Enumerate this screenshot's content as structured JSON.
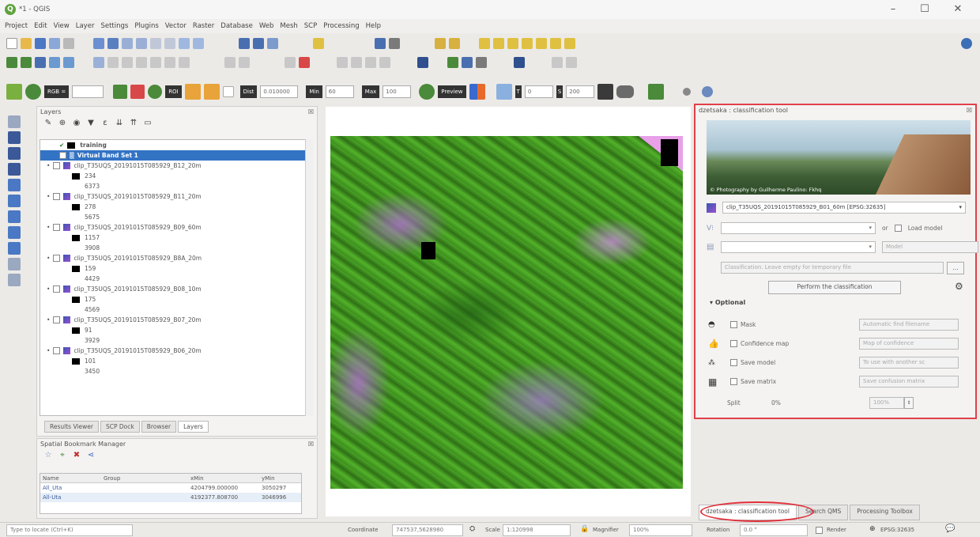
{
  "window": {
    "title": "*1 - QGIS",
    "minimize": "–",
    "maximize": "☐",
    "close": "✕"
  },
  "menu": [
    "Project",
    "Edit",
    "View",
    "Layer",
    "Settings",
    "Plugins",
    "Vector",
    "Raster",
    "Database",
    "Web",
    "Mesh",
    "SCP",
    "Processing",
    "Help"
  ],
  "toolbar": {
    "rgb_select": "RGB =",
    "roi_btn": "ROI",
    "dist_label": "Dist",
    "dist_value": "0.010000",
    "min_label": "Min",
    "min_value": "60",
    "max_label": "Max",
    "max_value": "100",
    "preview_btn": "Preview",
    "t_value": "0",
    "s_value": "200",
    "colors": {
      "yellow": "#f2c233",
      "green": "#4caf50",
      "orange": "#f57c00",
      "blue": "#2196f3",
      "red": "#e53935"
    }
  },
  "layers_panel": {
    "title": "Layers",
    "close": "☒",
    "items": [
      {
        "name": "training",
        "checked": true,
        "sub": null
      },
      {
        "name": "Virtual Band Set 1",
        "checked": true,
        "selected": true,
        "sub": null
      },
      {
        "name": "clip_T35UQS_20191015T085929_B12_20m",
        "checked": false,
        "min": "234",
        "max": "6373"
      },
      {
        "name": "clip_T35UQS_20191015T085929_B11_20m",
        "checked": false,
        "min": "278",
        "max": "5675"
      },
      {
        "name": "clip_T35UQS_20191015T085929_B09_60m",
        "checked": false,
        "min": "1157",
        "max": "3908"
      },
      {
        "name": "clip_T35UQS_20191015T085929_B8A_20m",
        "checked": false,
        "min": "159",
        "max": "4429"
      },
      {
        "name": "clip_T35UQS_20191015T085929_B08_10m",
        "checked": false,
        "min": "175",
        "max": "4569"
      },
      {
        "name": "clip_T35UQS_20191015T085929_B07_20m",
        "checked": false,
        "min": "91",
        "max": "3929"
      },
      {
        "name": "clip_T35UQS_20191015T085929_B06_20m",
        "checked": false,
        "min": "101",
        "max": "3450"
      }
    ],
    "tabs": [
      "Results Viewer",
      "SCP Dock",
      "Browser",
      "Layers"
    ],
    "active_tab": "Layers"
  },
  "bookmarks": {
    "title": "Spatial Bookmark Manager",
    "columns": [
      "Name",
      "Group",
      "xMin",
      "yMin"
    ],
    "rows": [
      {
        "name": "All_Uta",
        "group": "",
        "xmin": "4204799.000000",
        "ymin": "3050297"
      },
      {
        "name": "All-Uta",
        "group": "",
        "xmin": "4192377.808700",
        "ymin": "3046996"
      }
    ]
  },
  "classification_panel": {
    "title": "dzetsaka : classification tool",
    "photo_credit": "© Photography by Guilherme Paulino: Fkhq",
    "raster_select": "clip_T35UQS_20191015T085929_B01_60m [EPSG:32635]",
    "or_label": "or",
    "load_model": "Load model",
    "model_placeholder": "Model",
    "output_placeholder": "Classification. Leave empty for temporary file",
    "browse": "…",
    "perform_btn": "Perform the classification",
    "optional_label": "Optional",
    "options": [
      {
        "label": "Mask",
        "icon": "mask-icon",
        "placeholder": "Automatic find filename"
      },
      {
        "label": "Confidence map",
        "icon": "thumbs-up-icon",
        "placeholder": "Map of confidence"
      },
      {
        "label": "Save model",
        "icon": "model-icon",
        "placeholder": "To use with another sc"
      },
      {
        "label": "Save matrix",
        "icon": "matrix-icon",
        "placeholder": "Save confusion matrix"
      }
    ],
    "split_label": "Split",
    "split_value": "0%",
    "split_spin": "100%"
  },
  "bottom_tabs": [
    "dzetsaka : classification tool",
    "Search QMS",
    "Processing Toolbox"
  ],
  "statusbar": {
    "locator_placeholder": "Type to locate (Ctrl+K)",
    "coordinate_label": "Coordinate",
    "coordinate": "747537,5628980",
    "scale_label": "Scale",
    "scale": "1:120998",
    "magnifier_label": "Magnifier",
    "magnifier": "100%",
    "rotation_label": "Rotation",
    "rotation": "0.0 °",
    "render": "Render",
    "crs": "EPSG:32635"
  }
}
